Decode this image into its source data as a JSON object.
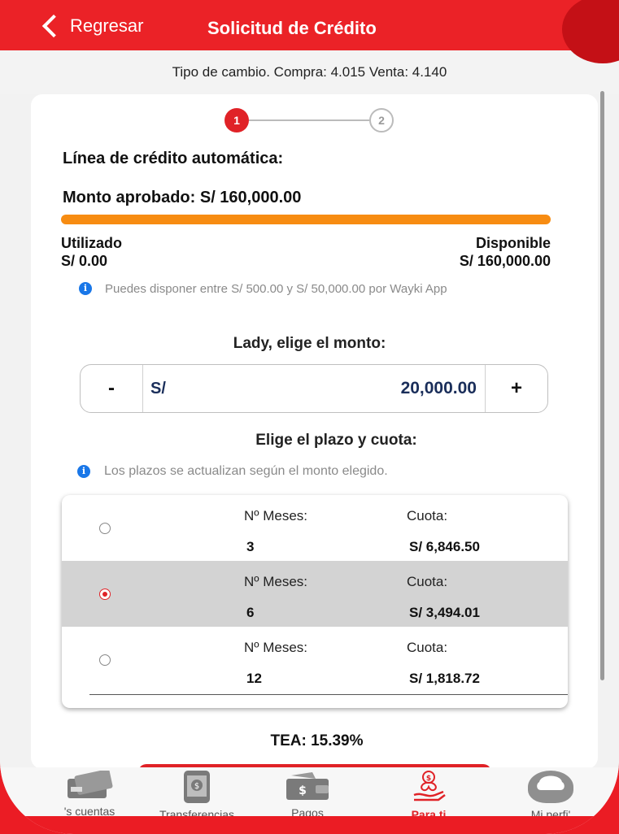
{
  "header": {
    "back_label": "Regresar",
    "title": "Solicitud de Crédito"
  },
  "exchange_rate": "Tipo de cambio. Compra: 4.015 Venta: 4.140",
  "stepper": {
    "step1": "1",
    "step2": "2",
    "current_step": 1
  },
  "credit": {
    "heading": "Línea de crédito automática:",
    "approved": "Monto aprobado: S/ 160,000.00",
    "used_fraction": 0,
    "used_label": "Utilizado",
    "used_value": "S/ 0.00",
    "available_label": "Disponible",
    "available_value": "S/ 160,000.00",
    "info": "Puedes disponer entre S/ 500.00 y S/ 50,000.00 por Wayki App"
  },
  "amount": {
    "heading": "Lady, elige el monto:",
    "minus": "-",
    "currency": "S/",
    "value": "20,000.00",
    "plus": "+"
  },
  "term": {
    "heading": "Elige el plazo y cuota:",
    "info": "Los plazos se actualizan según el monto elegido.",
    "options": [
      {
        "months_label": "Nº Meses:",
        "months": "3",
        "quota_label": "Cuota:",
        "quota": "S/ 6,846.50",
        "selected": false
      },
      {
        "months_label": "Nº Meses:",
        "months": "6",
        "quota_label": "Cuota:",
        "quota": "S/ 3,494.01",
        "selected": true
      },
      {
        "months_label": "Nº Meses:",
        "months": "12",
        "quota_label": "Cuota:",
        "quota": "S/ 1,818.72",
        "selected": false
      }
    ]
  },
  "tea": "TEA: 15.39%",
  "tabs": [
    {
      "label": "'s cuentas",
      "icon": "card-icon"
    },
    {
      "label": "Transferencias",
      "icon": "phone-transfer-icon"
    },
    {
      "label": "Pagos",
      "icon": "wallet-icon"
    },
    {
      "label": "Para ti",
      "icon": "gift-hand-icon",
      "active": true
    },
    {
      "label": "Mi perfi'",
      "icon": "avatar-icon"
    }
  ],
  "colors": {
    "brand_red": "#e02227",
    "progress_orange": "#f78c12",
    "amount_text": "#1a2e5a",
    "info_blue": "#1977e8"
  }
}
